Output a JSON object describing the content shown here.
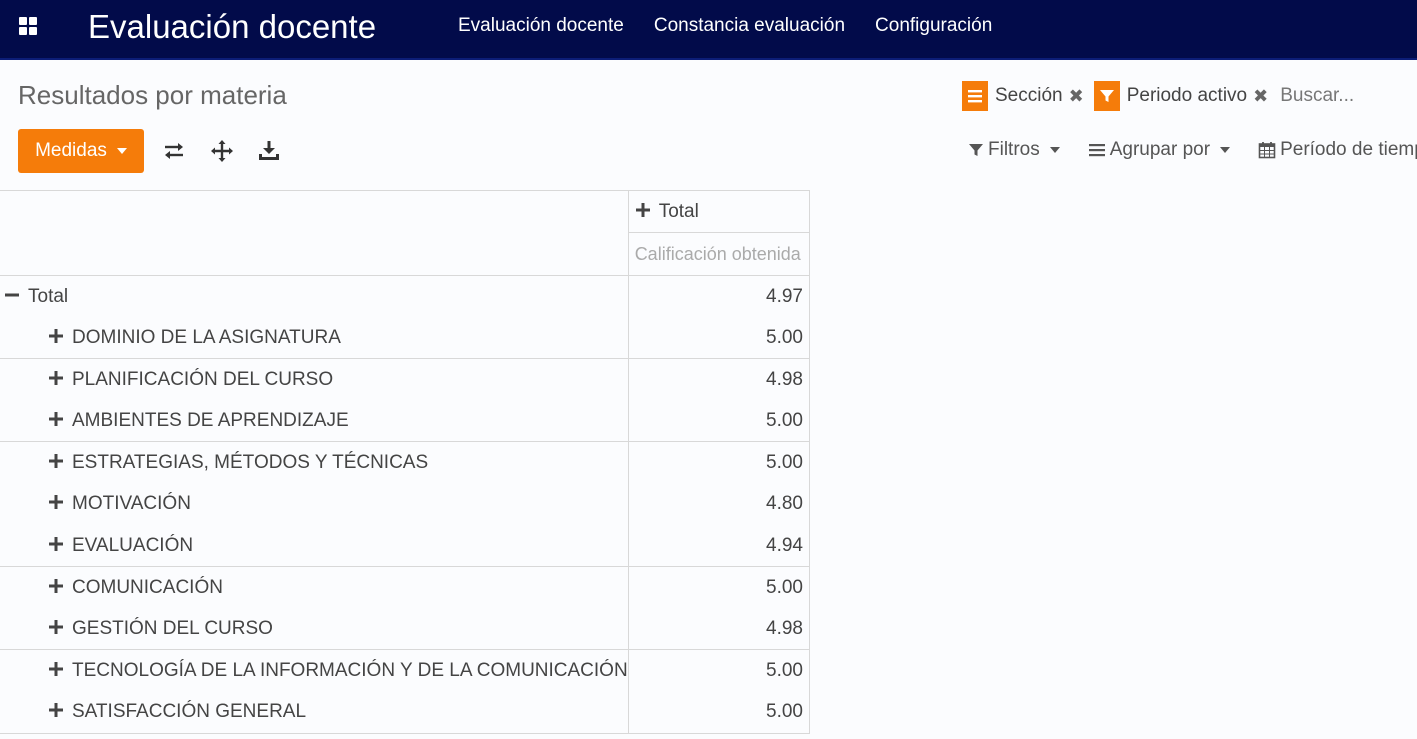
{
  "navbar": {
    "app_title": "Evaluación docente",
    "menu": [
      "Evaluación docente",
      "Constancia evaluación",
      "Configuración"
    ]
  },
  "control_panel": {
    "page_title": "Resultados por materia",
    "facets": [
      {
        "icon": "list-icon",
        "label": "Sección"
      },
      {
        "icon": "filter-icon",
        "label": "Periodo activo"
      }
    ],
    "search_placeholder": "Buscar...",
    "measures_label": "Medidas",
    "filters_label": "Filtros",
    "group_by_label": "Agrupar por",
    "time_period_label": "Período de tiempo"
  },
  "pivot": {
    "col_header": "Total",
    "measure": "Calificación obtenida",
    "total": {
      "label": "Total",
      "value": "4.97"
    },
    "rows": [
      {
        "label": "DOMINIO DE LA ASIGNATURA",
        "value": "5.00"
      },
      {
        "label": "PLANIFICACIÓN DEL CURSO",
        "value": "4.98"
      },
      {
        "label": "AMBIENTES DE APRENDIZAJE",
        "value": "5.00"
      },
      {
        "label": "ESTRATEGIAS, MÉTODOS Y TÉCNICAS",
        "value": "5.00"
      },
      {
        "label": "MOTIVACIÓN",
        "value": "4.80"
      },
      {
        "label": "EVALUACIÓN",
        "value": "4.94"
      },
      {
        "label": "COMUNICACIÓN",
        "value": "5.00"
      },
      {
        "label": "GESTIÓN DEL CURSO",
        "value": "4.98"
      },
      {
        "label": "TECNOLOGÍA DE LA INFORMACIÓN Y DE LA COMUNICACIÓN",
        "value": "5.00"
      },
      {
        "label": "SATISFACCIÓN GENERAL",
        "value": "5.00"
      }
    ]
  },
  "colors": {
    "navbar": "#020b4a",
    "accent": "#f57c0a"
  }
}
